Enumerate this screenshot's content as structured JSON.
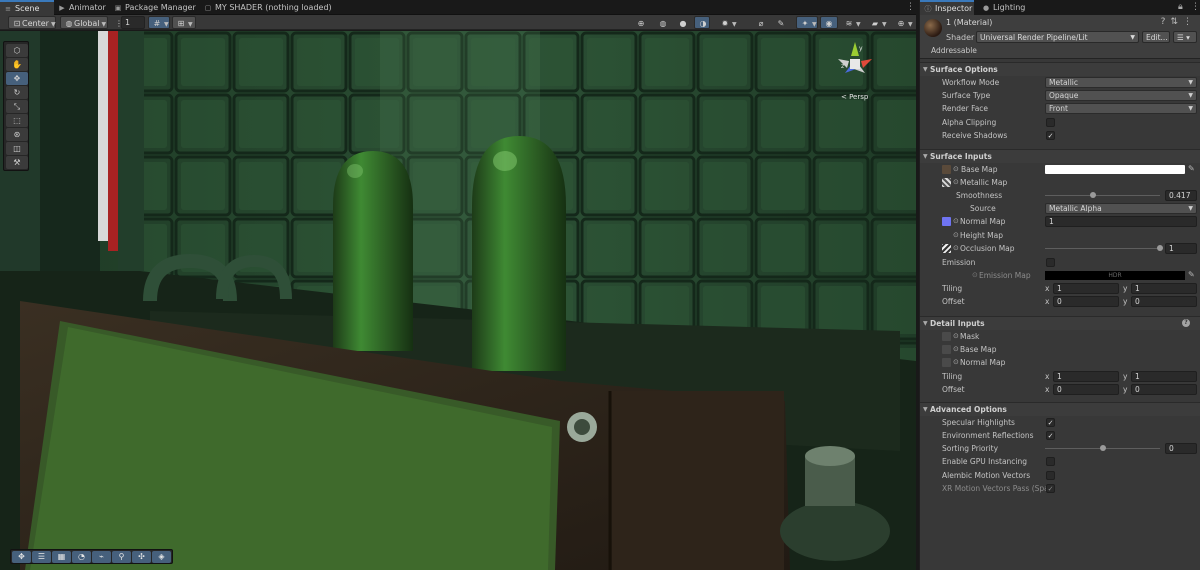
{
  "tabs": {
    "scene": "Scene",
    "animator": "Animator",
    "package_manager": "Package Manager",
    "shader": "MY SHADER (nothing loaded)"
  },
  "scene_toolbar": {
    "pivot": "Center",
    "space": "Global",
    "snap_value": "1"
  },
  "scene_view": {
    "projection": "< Persp"
  },
  "inspector": {
    "tabs": {
      "inspector": "Inspector",
      "lighting": "Lighting"
    },
    "material_name": "1 (Material)",
    "shader_label": "Shader",
    "shader_value": "Universal Render Pipeline/Lit",
    "edit_button": "Edit...",
    "addressable": "Addressable",
    "surface_options": {
      "title": "Surface Options",
      "workflow_mode": {
        "label": "Workflow Mode",
        "value": "Metallic"
      },
      "surface_type": {
        "label": "Surface Type",
        "value": "Opaque"
      },
      "render_face": {
        "label": "Render Face",
        "value": "Front"
      },
      "alpha_clipping": {
        "label": "Alpha Clipping",
        "checked": false
      },
      "receive_shadows": {
        "label": "Receive Shadows",
        "checked": true
      }
    },
    "surface_inputs": {
      "title": "Surface Inputs",
      "base_map": "Base Map",
      "base_color": "#ffffff",
      "metallic_map": "Metallic Map",
      "smoothness": {
        "label": "Smoothness",
        "value": "0.417",
        "fraction": 0.417
      },
      "source": {
        "label": "Source",
        "value": "Metallic Alpha"
      },
      "normal_map": {
        "label": "Normal Map",
        "value": "1"
      },
      "height_map": "Height Map",
      "occlusion_map": {
        "label": "Occlusion Map",
        "value": "1",
        "fraction": 1.0
      },
      "emission": {
        "label": "Emission",
        "checked": false
      },
      "emission_map": {
        "label": "Emission Map",
        "badge": "HDR"
      },
      "tiling": {
        "label": "Tiling",
        "x": "1",
        "y": "1"
      },
      "offset": {
        "label": "Offset",
        "x": "0",
        "y": "0"
      }
    },
    "detail_inputs": {
      "title": "Detail Inputs",
      "mask": "Mask",
      "base_map": "Base Map",
      "normal_map": "Normal Map",
      "tiling": {
        "label": "Tiling",
        "x": "1",
        "y": "1"
      },
      "offset": {
        "label": "Offset",
        "x": "0",
        "y": "0"
      }
    },
    "advanced_options": {
      "title": "Advanced Options",
      "specular_highlights": {
        "label": "Specular Highlights",
        "checked": true
      },
      "environment_reflections": {
        "label": "Environment Reflections",
        "checked": true
      },
      "sorting_priority": {
        "label": "Sorting Priority",
        "value": "0",
        "fraction": 0.5
      },
      "gpu_instancing": {
        "label": "Enable GPU Instancing",
        "checked": false
      },
      "alembic": {
        "label": "Alembic Motion Vectors",
        "checked": false
      },
      "xr_motion": {
        "label": "XR Motion Vectors Pass (Spa",
        "checked": true
      }
    }
  },
  "axis_labels": {
    "x": "x",
    "y": "y",
    "z": "z"
  },
  "colors": {
    "accent": "#3a79bb",
    "normal_map_icon": "#6f74f2",
    "scene_green": "#24442c"
  }
}
